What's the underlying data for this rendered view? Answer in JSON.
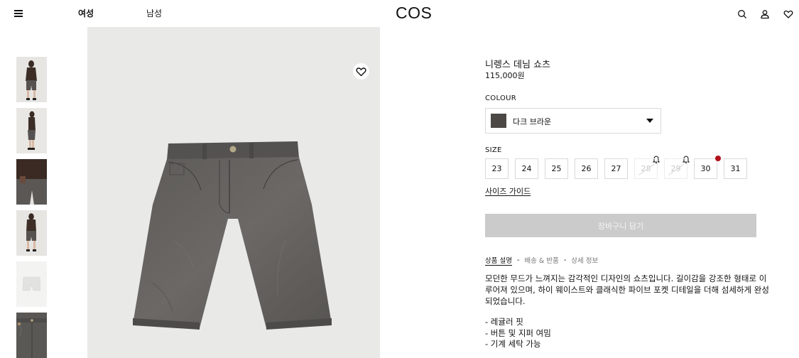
{
  "header": {
    "nav_women": "여성",
    "nav_men": "남성",
    "logo": "COS",
    "icons": [
      "menu-icon",
      "search-icon",
      "account-icon",
      "wishlist-heart-icon"
    ]
  },
  "gallery": {
    "thumbnails": [
      "thumbnail-1",
      "thumbnail-2",
      "thumbnail-3",
      "thumbnail-4",
      "thumbnail-5",
      "thumbnail-6"
    ],
    "favorite_icon": "heart-icon"
  },
  "product": {
    "title": "니렝스 데님 쇼츠",
    "price": "115,000원",
    "colour_label": "COLOUR",
    "colour_value": "다크 브라운",
    "colour_swatch": "#4b4846",
    "size_label": "SIZE",
    "sizes": [
      {
        "label": "23",
        "available": true
      },
      {
        "label": "24",
        "available": true
      },
      {
        "label": "25",
        "available": true
      },
      {
        "label": "26",
        "available": true
      },
      {
        "label": "27",
        "available": true
      },
      {
        "label": "28",
        "available": false
      },
      {
        "label": "29",
        "available": false
      },
      {
        "label": "30",
        "available": true
      },
      {
        "label": "31",
        "available": true
      }
    ],
    "size_guide": "사이즈 가이드",
    "add_to_cart": "장바구니 담기"
  },
  "tabs": {
    "description": "상품 설명",
    "shipping": "배송 & 반품",
    "details": "상세 정보",
    "separator": "-"
  },
  "description": {
    "text": "모던한 무드가 느껴지는 감각적인 디자인의 쇼츠입니다. 길이감을 강조한 형태로 이루어져 있으며, 하이 웨이스트와 클래식한 파이브 포켓 디테일을 더해 섬세하게 완성되었습니다.",
    "bullets": [
      "- 레귤러 핏",
      "- 버튼 및 지퍼 여밈",
      "- 기계 세탁 가능"
    ]
  },
  "colors": {
    "accent_dot": "#b3111a",
    "cart_button": "#cbcbcb"
  }
}
